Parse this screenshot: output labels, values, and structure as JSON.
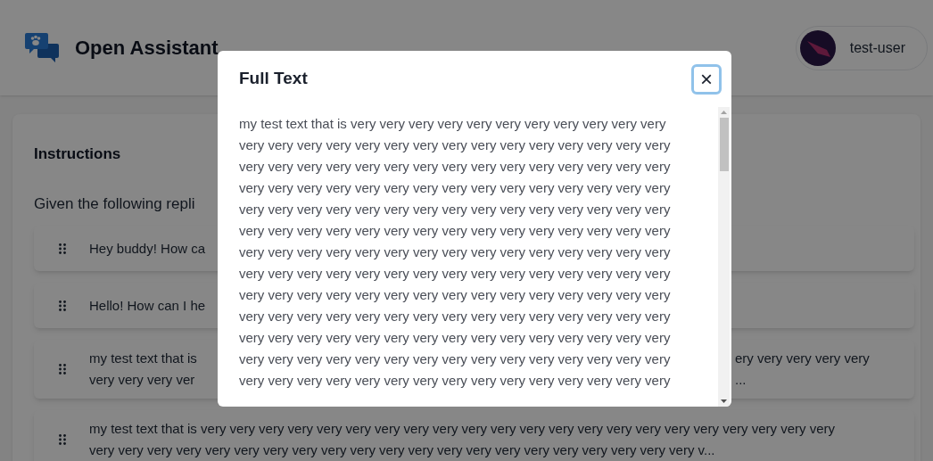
{
  "header": {
    "title": "Open Assistant",
    "user": {
      "name": "test-user"
    }
  },
  "instructions": {
    "title": "Instructions",
    "prompt": "Given the following repli"
  },
  "replies": [
    {
      "left": [
        "Hey buddy! How ca"
      ]
    },
    {
      "left": [
        "Hello! How can I he"
      ]
    },
    {
      "left": [
        "my test text that is",
        "very very very ver"
      ],
      "right": [
        "ery very very very very",
        "..."
      ]
    },
    {
      "left": [
        "my test text that is very very very very very very very very very very very very very very very very very very very very very very",
        "very very very very very very very very very very very very very very very very very very very very very v..."
      ]
    }
  ],
  "modal": {
    "title": "Full Text",
    "close": "×",
    "lines": [
      "my test text that is very very very very very very very very very very very",
      "very very very very very very very very very very very very very very very",
      "very very very very very very very very very very very very very very very",
      "very very very very very very very very very very very very very very very",
      "very very very very very very very very very very very very very very very",
      "very very very very very very very very very very very very very very very",
      "very very very very very very very very very very very very very very very",
      "very very very very very very very very very very very very very very very",
      "very very very very very very very very very very very very very very very",
      "very very very very very very very very very very very very very very very",
      "very very very very very very very very very very very very very very very",
      "very very very very very very very very very very very very very very very",
      "very very very very very very very very very very very very very very very"
    ]
  }
}
